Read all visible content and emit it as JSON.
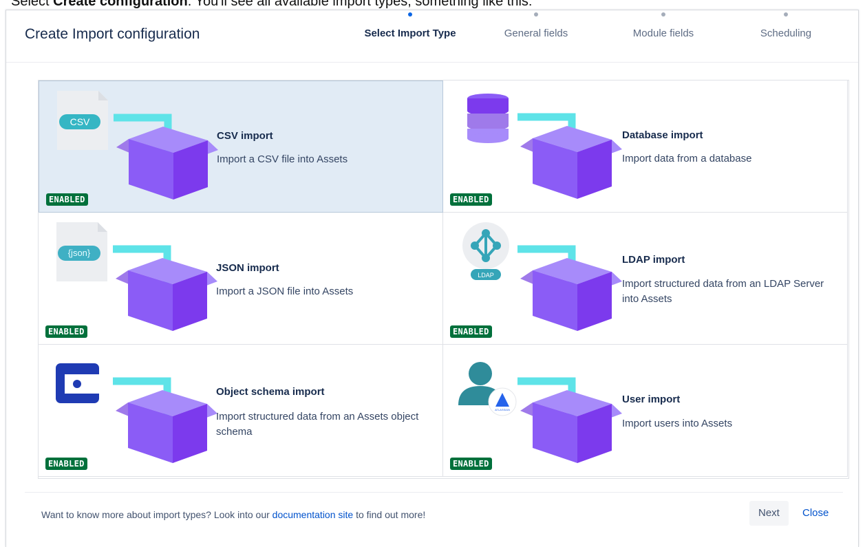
{
  "caption": {
    "bold": "Create configuration",
    "prefix": "Select ",
    "rest": ". You'll see all available import types, something like this:"
  },
  "modal": {
    "title": "Create Import configuration"
  },
  "steps": [
    {
      "label": "Select Import Type",
      "active": true
    },
    {
      "label": "General fields",
      "active": false
    },
    {
      "label": "Module fields",
      "active": false
    },
    {
      "label": "Scheduling",
      "active": false
    }
  ],
  "cards": [
    {
      "title": "CSV import",
      "desc": "Import a CSV file into Assets",
      "badge": "ENABLED",
      "icon": "csv-file-icon",
      "icon_label": "CSV",
      "selected": true
    },
    {
      "title": "Database import",
      "desc": "Import data from a database",
      "badge": "ENABLED",
      "icon": "database-icon",
      "selected": false
    },
    {
      "title": "JSON import",
      "desc": "Import a JSON file into Assets",
      "badge": "ENABLED",
      "icon": "json-file-icon",
      "icon_label": "{json}",
      "selected": false
    },
    {
      "title": "LDAP import",
      "desc": "Import structured data from an LDAP Server into Assets",
      "badge": "ENABLED",
      "icon": "ldap-icon",
      "icon_label": "LDAP",
      "selected": false
    },
    {
      "title": "Object schema import",
      "desc": "Import structured data from an Assets object schema",
      "badge": "ENABLED",
      "icon": "object-schema-icon",
      "selected": false
    },
    {
      "title": "User import",
      "desc": "Import users into Assets",
      "badge": "ENABLED",
      "icon": "user-icon",
      "icon_label": "ATLASSIAN",
      "selected": false
    }
  ],
  "footer": {
    "text_before": "Want to know more about import types? Look into our ",
    "link": "documentation site",
    "text_after": " to find out more!",
    "next_label": "Next",
    "close_label": "Close"
  },
  "colors": {
    "accent": "#0c66e4",
    "badge": "#00703b",
    "arrow": "#5ee3e8",
    "box": "#8b5cf6",
    "selected_bg": "#e1ebf5",
    "link": "#0052cc"
  }
}
